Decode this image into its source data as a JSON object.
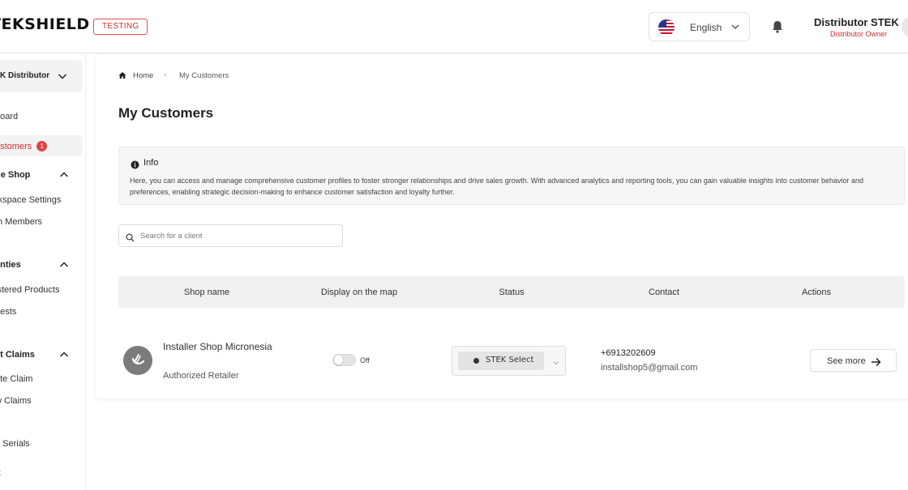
{
  "header": {
    "logo": "TEKSHIELD",
    "env_badge": "TESTING",
    "language": "English",
    "user_name": "Distributor STEK",
    "user_role": "Distributor Owner"
  },
  "sidebar": {
    "org": "K Distributor",
    "items": [
      {
        "label": "board"
      },
      {
        "label": "ustomers",
        "badge": "1"
      },
      {
        "label": "ge Shop"
      },
      {
        "label": "rkspace Settings"
      },
      {
        "label": "m Members"
      },
      {
        "label": "anties"
      },
      {
        "label": "istered Products"
      },
      {
        "label": "uests"
      },
      {
        "label": "ct Claims"
      },
      {
        "label": "ate Claim"
      },
      {
        "label": "w Claims"
      },
      {
        "label": "e Serials"
      },
      {
        "label": "rt"
      }
    ]
  },
  "breadcrumb": {
    "home": "Home",
    "separator": "›",
    "current": "My Customers"
  },
  "page": {
    "title": "My Customers"
  },
  "info": {
    "title": "Info",
    "text": "Here, you can access and manage comprehensive customer profiles to foster stronger relationships and drive sales growth. With advanced analytics and reporting tools, you can gain valuable insights into customer behavior and preferences, enabling strategic decision-making to enhance customer satisfaction and loyalty further."
  },
  "search": {
    "placeholder": "Search for a client",
    "value": ""
  },
  "table": {
    "columns": [
      "Shop name",
      "Display on the map",
      "Status",
      "Contact",
      "Actions"
    ],
    "rows": [
      {
        "shop_name": "Installer Shop Micronesia",
        "shop_type": "Authorized Retailer",
        "display_on_map": "Off",
        "status": "STEK Select",
        "phone": "+6913202609",
        "email": "installshop5@gmail.com",
        "action": "See more"
      }
    ]
  },
  "colors": {
    "accent": "#c9302c",
    "badge": "#e04444"
  }
}
